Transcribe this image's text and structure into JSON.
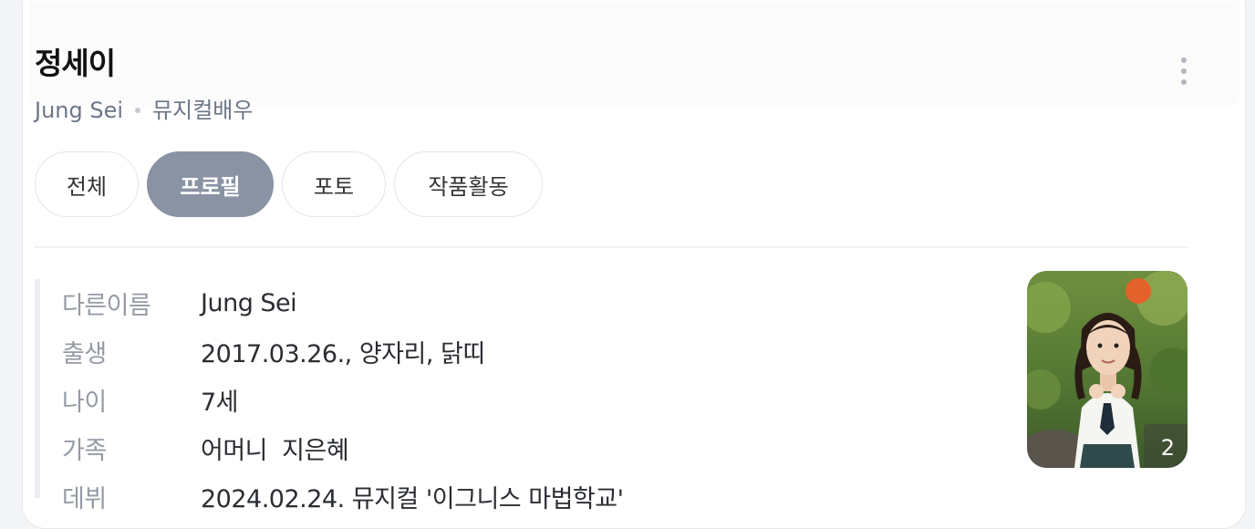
{
  "profile": {
    "name": "정세이",
    "english_name": "Jung Sei",
    "occupation": "뮤지컬배우"
  },
  "tabs": [
    {
      "label": "전체",
      "active": false
    },
    {
      "label": "프로필",
      "active": true
    },
    {
      "label": "포토",
      "active": false
    },
    {
      "label": "작품활동",
      "active": false
    }
  ],
  "info": [
    {
      "label": "다른이름",
      "value": "Jung Sei"
    },
    {
      "label": "출생",
      "value": "2017.03.26., 양자리, 닭띠"
    },
    {
      "label": "나이",
      "value": "7세"
    },
    {
      "label": "가족",
      "value": "어머니  지은혜"
    },
    {
      "label": "데뷔",
      "value": "2024.02.24. 뮤지컬 '이그니스 마법학교'"
    }
  ],
  "photo": {
    "count": "2"
  },
  "icons": {
    "more": "more-vertical-icon"
  },
  "colors": {
    "active_tab": "#8993a3",
    "subtitle": "#6b7687",
    "label": "#959ba5"
  }
}
